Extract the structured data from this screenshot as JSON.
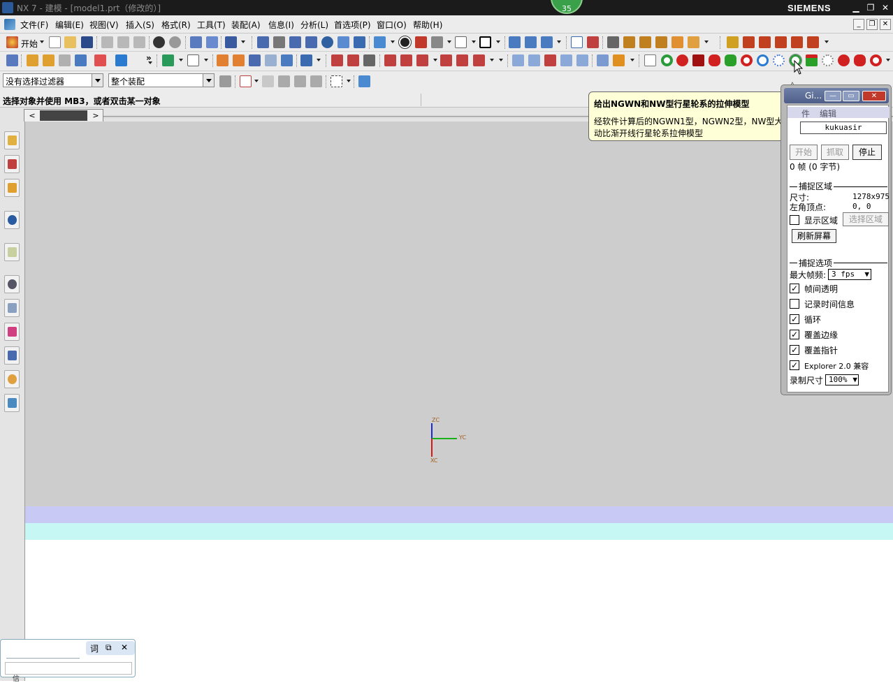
{
  "window": {
    "title": "NX 7 - 建模 - [model1.prt（修改的）]",
    "brand": "SIEMENS",
    "badge": "35",
    "controls": {
      "minimize": "▁",
      "restore": "❐",
      "close": "✕"
    }
  },
  "menu": {
    "items": [
      "文件(F)",
      "编辑(E)",
      "视图(V)",
      "插入(S)",
      "格式(R)",
      "工具(T)",
      "装配(A)",
      "信息(I)",
      "分析(L)",
      "首选项(P)",
      "窗口(O)",
      "帮助(H)"
    ]
  },
  "toolbar1": {
    "start_label": "开始"
  },
  "filterbar": {
    "filter_value": "没有选择过滤器",
    "scope_value": "整个装配"
  },
  "cue": {
    "text": "选择对象并使用 MB3，或者双击某一对象"
  },
  "tooltip": {
    "title": "给出NGWN和NW型行星轮系的拉伸模型",
    "body": "经软件计算后的NGWN1型，NGWN2型，NW型大传动比渐开线行星轮系拉伸模型"
  },
  "recorder": {
    "title": "Gi...",
    "menu_file": "件",
    "menu_edit": "编辑",
    "name": "kukuasir",
    "btn_start": "开始",
    "btn_grab": "抓取",
    "btn_stop": "停止",
    "frames": "0 帧 (0 字节)",
    "capture_area": "捕捉区域",
    "size_label": "尺寸:",
    "size_value": "1278x975",
    "corner_label": "左角顶点:",
    "corner_value": "0, 0",
    "show_area": "显示区域",
    "select_area": "选择区域",
    "refresh": "刷新屏幕",
    "capture_opts": "捕捉选项",
    "max_fps_label": "最大帧频:",
    "max_fps_value": "3 fps",
    "opt_transparent": "帧间透明",
    "opt_timeinfo": "记录时间信息",
    "opt_loop": "循环",
    "opt_border": "覆盖边缘",
    "opt_pointer": "覆盖指针",
    "opt_explorer": "Explorer 2.0 兼容",
    "rec_size_label": "录制尺寸",
    "rec_size_value": "100%"
  },
  "axes": {
    "z": "ZC",
    "y": "YC",
    "x": "XC"
  },
  "mini": {
    "btn1": "词",
    "btn2": "⧉",
    "btn3": "✕"
  },
  "footer": {
    "text": "信"
  },
  "colors": {
    "canvas": "#cdcdcd",
    "band1": "#c9c9f5",
    "band2": "#c6f7f5",
    "tooltip": "#ffffd7"
  }
}
